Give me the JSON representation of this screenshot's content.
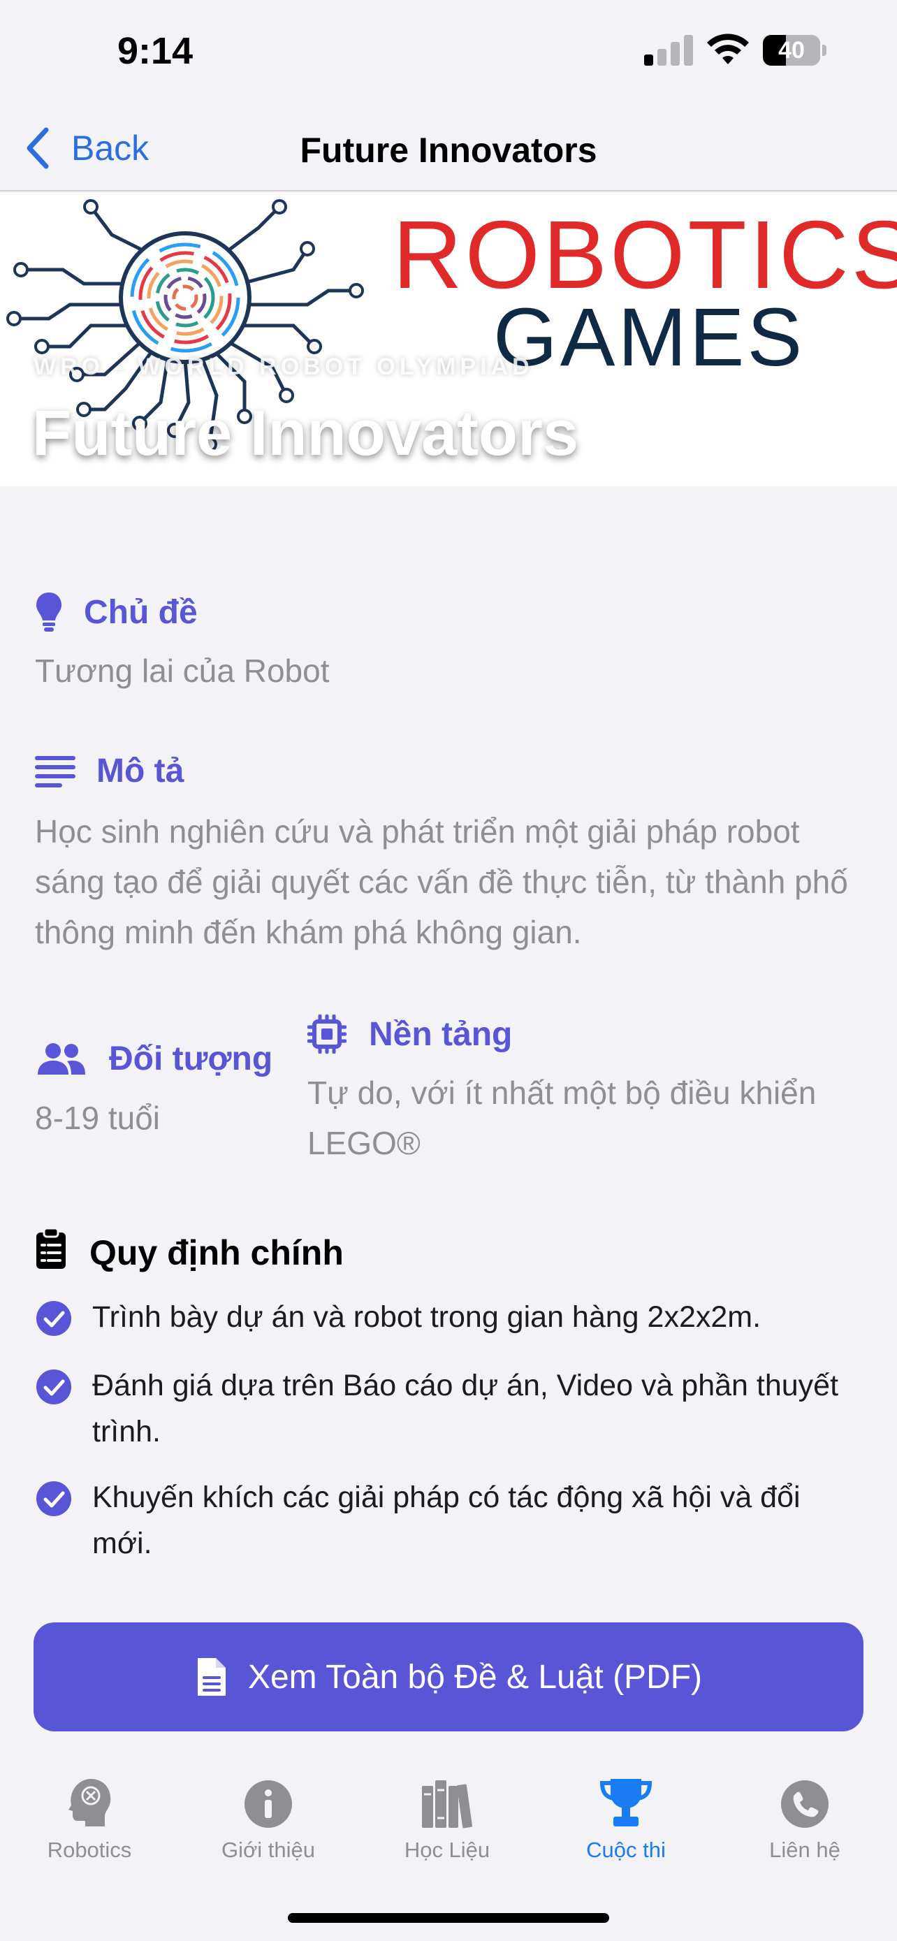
{
  "status_bar": {
    "time": "9:14",
    "battery_level": "40",
    "battery_fraction": 0.4,
    "signal_bars_active": 1
  },
  "nav": {
    "back_label": "Back",
    "title": "Future Innovators"
  },
  "hero": {
    "logo_line_1": "ROBOTICS",
    "logo_line_2": "GAMES",
    "overline": "WRO - WORLD ROBOT OLYMPIAD",
    "title": "Future Innovators"
  },
  "topic": {
    "heading": "Chủ đề",
    "value": "Tương lai của Robot",
    "icon": "lightbulb-icon"
  },
  "description": {
    "heading": "Mô tả",
    "value": "Học sinh nghiên cứu và phát triển một giải pháp robot sáng tạo để giải quyết các vấn đề thực tiễn, từ thành phố thông minh đến khám phá không gian.",
    "icon": "align-left-icon"
  },
  "audience": {
    "heading": "Đối tượng",
    "value": "8-19 tuổi",
    "icon": "users-icon"
  },
  "platform": {
    "heading": "Nền tảng",
    "value": "Tự do, với ít nhất một bộ điều khiển LEGO®",
    "icon": "chip-icon"
  },
  "rules": {
    "heading": "Quy định chính",
    "icon": "clipboard-icon",
    "items": [
      "Trình bày dự án và robot trong gian hàng 2x2x2m.",
      "Đánh giá dựa trên Báo cáo dự án, Video và phần thuyết trình.",
      "Khuyến khích các giải pháp có tác động xã hội và đổi mới."
    ]
  },
  "pdf_button": {
    "label": "Xem Toàn bộ Đề & Luật (PDF)",
    "icon": "file-icon"
  },
  "tabs": [
    {
      "label": "Robotics",
      "icon": "brain-head-icon",
      "active": false
    },
    {
      "label": "Giới thiệu",
      "icon": "info-circle-icon",
      "active": false
    },
    {
      "label": "Học Liệu",
      "icon": "books-icon",
      "active": false
    },
    {
      "label": "Cuộc thi",
      "icon": "trophy-icon",
      "active": true
    },
    {
      "label": "Liên hệ",
      "icon": "phone-icon",
      "active": false
    }
  ],
  "colors": {
    "accent": "#5856d6",
    "tab_active": "#1a7cf5",
    "back_blue": "#2a6fe0",
    "logo_red": "#e02a2a",
    "logo_navy": "#0f2a44",
    "secondary_text": "#8e8e93"
  }
}
